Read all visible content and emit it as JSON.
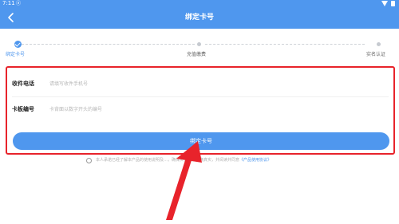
{
  "status_bar": {
    "time": "7:11",
    "notification": "ⓐ",
    "wifi_icon": "wifi-icon",
    "battery_icon": "battery-icon"
  },
  "header": {
    "title": "绑定卡号",
    "back_icon": "back-icon",
    "background_color": "#4f97ee"
  },
  "steps": [
    {
      "label": "绑定卡号",
      "status": "done"
    },
    {
      "label": "充值缴费",
      "status": "todo"
    },
    {
      "label": "实名认证",
      "status": "todo"
    }
  ],
  "form": {
    "phone": {
      "label": "收件电话",
      "value": "",
      "placeholder": "请填写收件手机号"
    },
    "card": {
      "label": "卡板编号",
      "value": "",
      "placeholder": "卡背面以数字开头的编号"
    },
    "submit_label": "绑定卡号",
    "highlight_color": "#e8232b"
  },
  "agreement": {
    "checked": false,
    "text": "本人承诺已经了解本产品的使用说明及…，确保实名认证准确真实，并阅读并同意",
    "link_text": "《产品使用协议》"
  },
  "annotation": {
    "arrow_color": "#e8232b",
    "arrow_icon": "annotation-arrow-icon"
  }
}
